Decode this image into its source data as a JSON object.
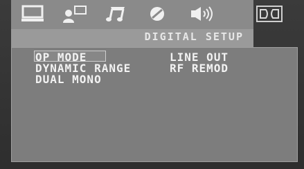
{
  "header": {
    "title": "DIGITAL SETUP"
  },
  "icons": [
    {
      "name": "monitor-icon"
    },
    {
      "name": "user-display-icon"
    },
    {
      "name": "music-note-icon"
    },
    {
      "name": "disc-icon"
    },
    {
      "name": "speaker-icon"
    },
    {
      "name": "dolby-icon"
    }
  ],
  "menu": {
    "items": [
      {
        "label": "OP MODE",
        "value": "LINE OUT",
        "selected": true
      },
      {
        "label": "DYNAMIC RANGE",
        "value": "RF REMOD"
      },
      {
        "label": "DUAL MONO"
      }
    ]
  },
  "colors": {
    "background": "#2e2e2e",
    "iconbar": "#8a8a8a",
    "panel": "#7d7d7d",
    "text": "#f2f2f2"
  }
}
